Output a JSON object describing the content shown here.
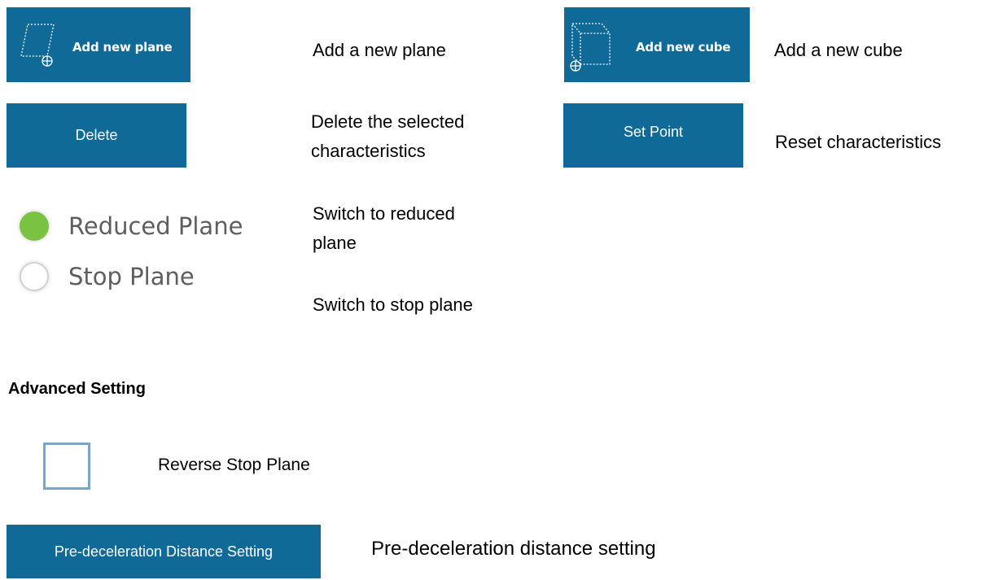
{
  "rows": {
    "add_plane": {
      "button_label": "Add new plane",
      "icon": "plane-add-icon",
      "description": "Add a new plane"
    },
    "add_cube": {
      "button_label": "Add new cube",
      "icon": "cube-add-icon",
      "description": "Add a new cube"
    },
    "delete": {
      "button_label": "Delete",
      "description_line1": "Delete the selected",
      "description_line2": "characteristics"
    },
    "set_point": {
      "button_label": "Set Point",
      "description": "Reset characteristics"
    },
    "plane_mode": {
      "reduced_label": "Reduced Plane",
      "reduced_selected": true,
      "stop_label": "Stop Plane",
      "stop_selected": false,
      "reduced_description_line1": "Switch to reduced",
      "reduced_description_line2": "plane",
      "stop_description": "Switch to stop plane"
    }
  },
  "advanced": {
    "title": "Advanced Setting",
    "reverse_checkbox": {
      "label": "Reverse Stop Plane",
      "checked": false
    },
    "predecel": {
      "button_label": "Pre-deceleration Distance Setting",
      "description": "Pre-deceleration distance setting"
    }
  },
  "colors": {
    "button_bg": "#0f6a98",
    "radio_selected": "#7ac242",
    "checkbox_border": "#7ba5c6"
  }
}
